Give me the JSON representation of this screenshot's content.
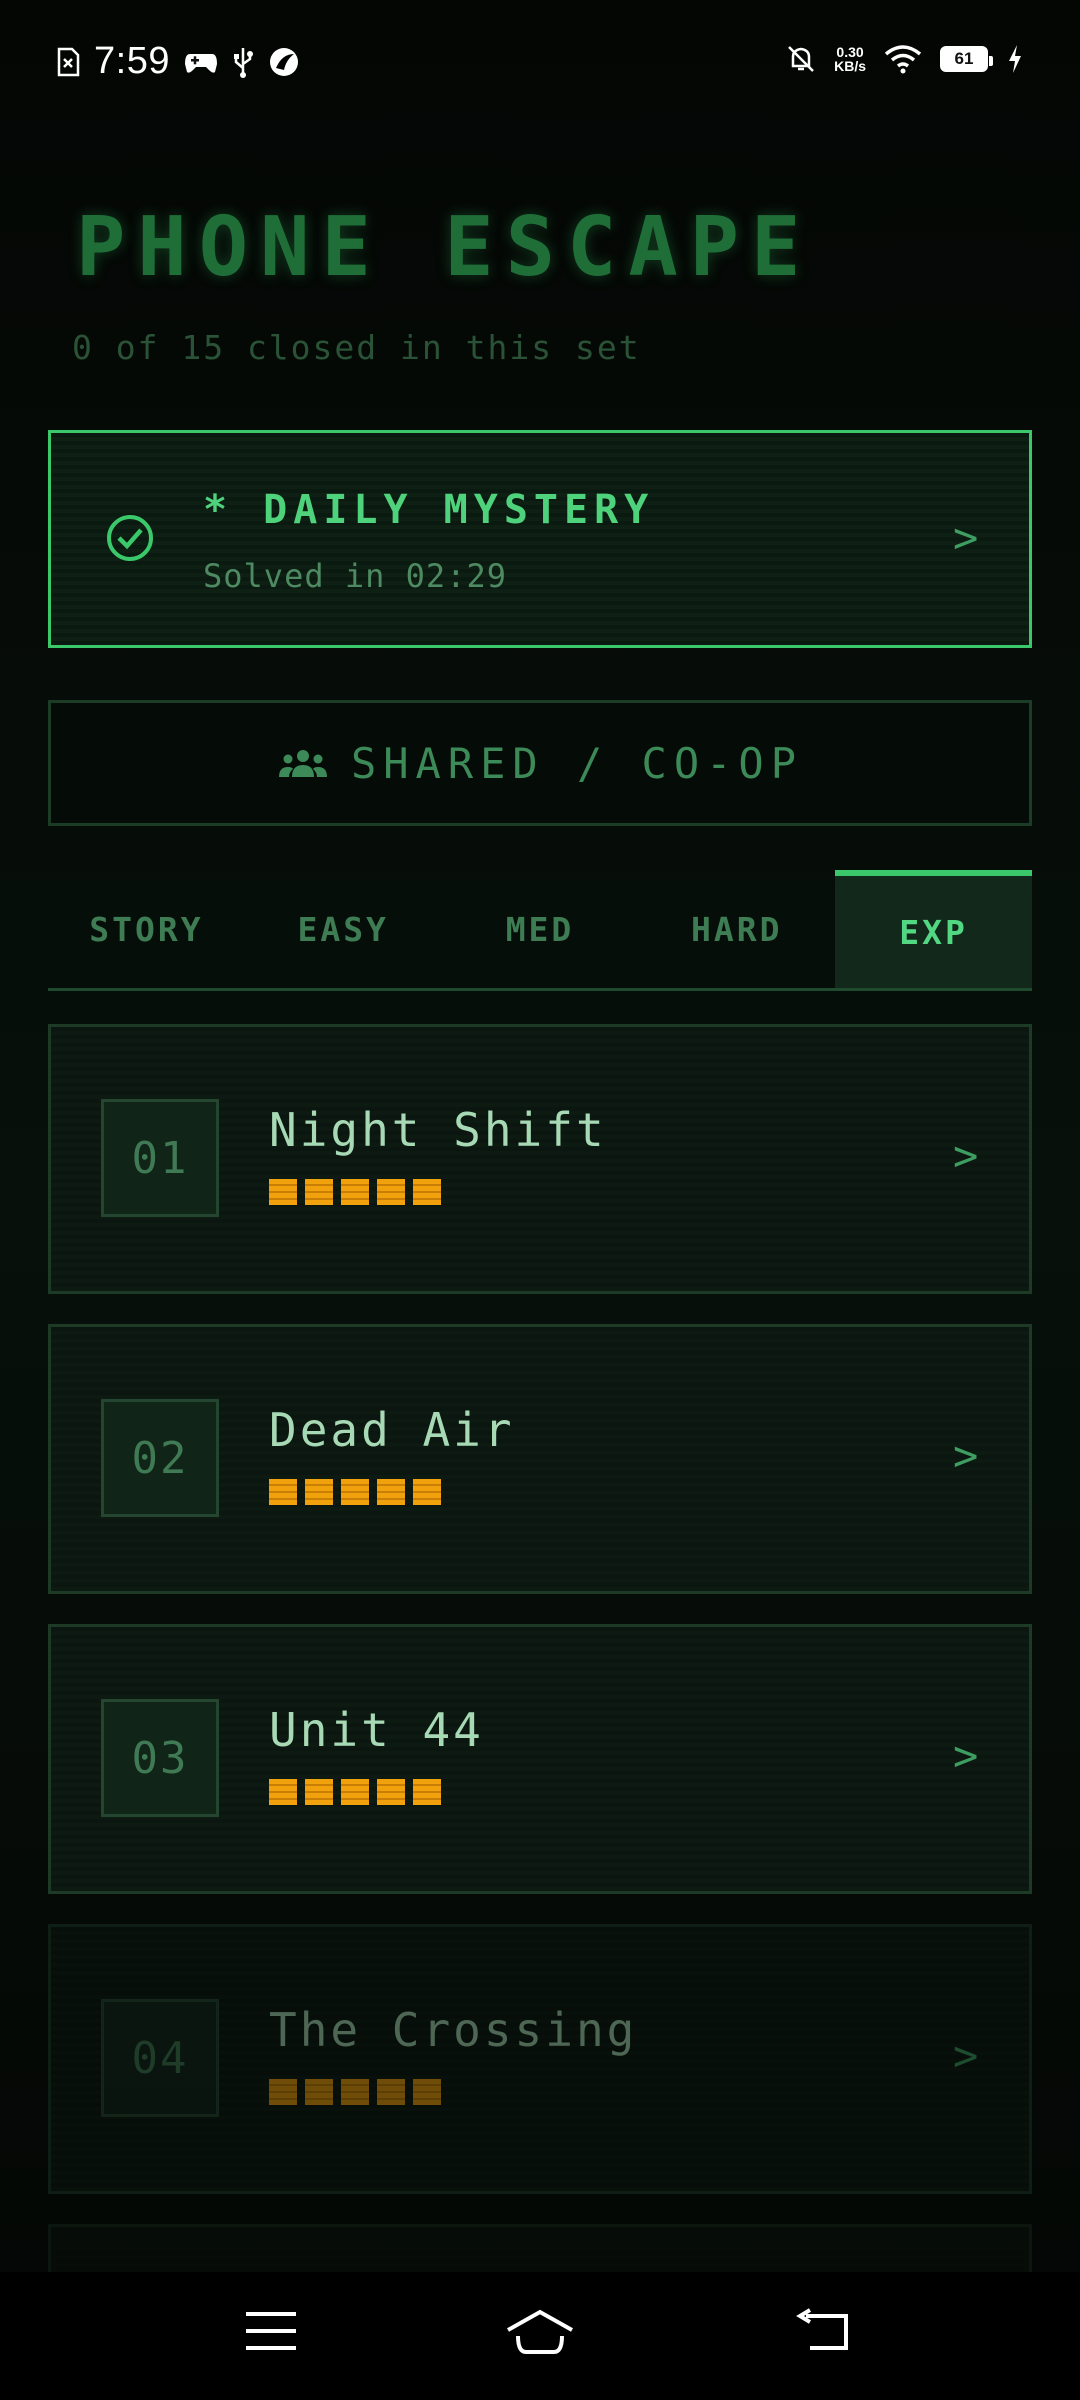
{
  "status_bar": {
    "time": "7:59",
    "net_speed_value": "0.30",
    "net_speed_unit": "KB/s",
    "battery": "61",
    "left_icons": [
      "sim-error-icon",
      "gamepad-icon",
      "usb-icon",
      "app-icon"
    ],
    "right_icons": [
      "bell-off-icon",
      "wifi-icon",
      "battery-icon",
      "charging-icon"
    ]
  },
  "header": {
    "title": "PHONE ESCAPE",
    "subtitle": "0 of 15 closed in this set"
  },
  "daily": {
    "title": "* DAILY MYSTERY",
    "subtitle": "Solved in 02:29",
    "chevron": ">",
    "icon": "check-circle-icon"
  },
  "shared": {
    "label": "SHARED / CO-OP",
    "icon": "group-icon"
  },
  "tabs": [
    {
      "label": "STORY",
      "active": false
    },
    {
      "label": "EASY",
      "active": false
    },
    {
      "label": "MED",
      "active": false
    },
    {
      "label": "HARD",
      "active": false
    },
    {
      "label": "EXP",
      "active": true
    }
  ],
  "levels": [
    {
      "number": "01",
      "name": "Night Shift",
      "difficulty": 5,
      "chevron": ">",
      "locked": false
    },
    {
      "number": "02",
      "name": "Dead Air",
      "difficulty": 5,
      "chevron": ">",
      "locked": false
    },
    {
      "number": "03",
      "name": "Unit 44",
      "difficulty": 5,
      "chevron": ">",
      "locked": false
    },
    {
      "number": "04",
      "name": "The Crossing",
      "difficulty": 5,
      "chevron": ">",
      "locked": true
    }
  ],
  "nav_bar": {
    "icons": [
      "menu-icon",
      "home-icon",
      "back-icon"
    ]
  },
  "colors": {
    "accent": "#3ac86a",
    "title": "#1f6e38",
    "difficulty": "#f1a10c",
    "background": "#050a07"
  }
}
